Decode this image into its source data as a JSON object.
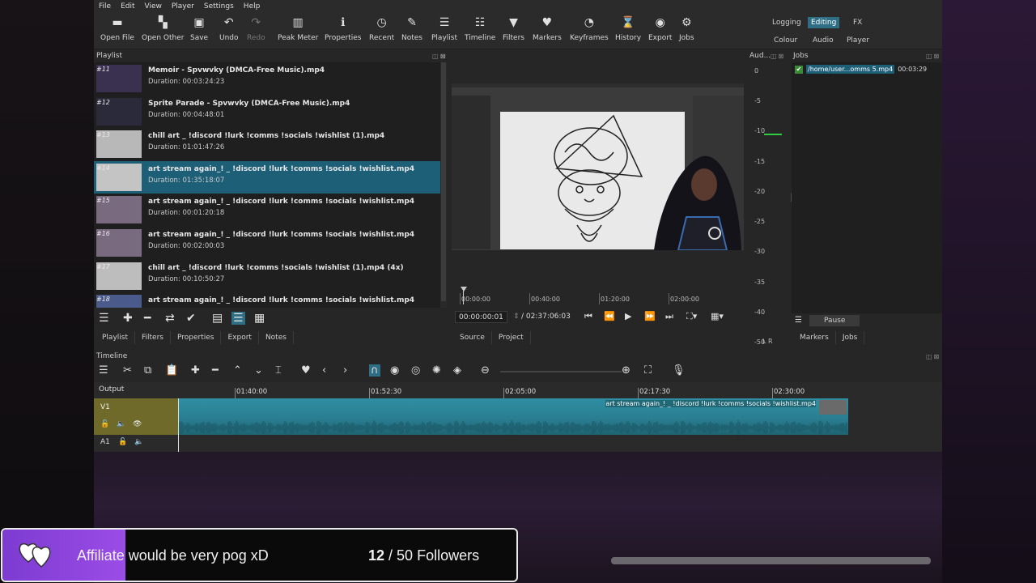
{
  "menu": [
    "File",
    "Edit",
    "View",
    "Player",
    "Settings",
    "Help"
  ],
  "toolbar": [
    {
      "label": "Open File",
      "icon": "open-file-icon",
      "glyph": "▬"
    },
    {
      "label": "Open Other",
      "icon": "open-other-icon",
      "glyph": "▚"
    },
    {
      "label": "Save",
      "icon": "save-icon",
      "glyph": "▣"
    },
    {
      "label": "Undo",
      "icon": "undo-icon",
      "glyph": "↶"
    },
    {
      "label": "Redo",
      "icon": "redo-icon",
      "glyph": "↷"
    },
    {
      "label": "Peak Meter",
      "icon": "peak-meter-icon",
      "glyph": "▥"
    },
    {
      "label": "Properties",
      "icon": "properties-icon",
      "glyph": "ℹ"
    },
    {
      "label": "Recent",
      "icon": "recent-icon",
      "glyph": "◷"
    },
    {
      "label": "Notes",
      "icon": "notes-icon",
      "glyph": "✎"
    },
    {
      "label": "Playlist",
      "icon": "playlist-icon",
      "glyph": "☰"
    },
    {
      "label": "Timeline",
      "icon": "timeline-icon",
      "glyph": "☷"
    },
    {
      "label": "Filters",
      "icon": "filters-icon",
      "glyph": "▼"
    },
    {
      "label": "Markers",
      "icon": "markers-icon",
      "glyph": "♥"
    },
    {
      "label": "Keyframes",
      "icon": "keyframes-icon",
      "glyph": "◔"
    },
    {
      "label": "History",
      "icon": "history-icon",
      "glyph": "⌛"
    },
    {
      "label": "Export",
      "icon": "export-icon",
      "glyph": "◉"
    },
    {
      "label": "Jobs",
      "icon": "jobs-icon",
      "glyph": "⚙"
    }
  ],
  "layouts": {
    "row1": [
      "Logging",
      "Editing",
      "FX"
    ],
    "row2": [
      "Colour",
      "Audio",
      "Player"
    ],
    "active": "Editing"
  },
  "playlist": {
    "title": "Playlist",
    "items": [
      {
        "num": "#11",
        "name": "Memoir - Spvwvky (DMCA-Free Music).mp4",
        "duration": "Duration: 00:03:24:23",
        "thumb": "#3a3050",
        "selected": false
      },
      {
        "num": "#12",
        "name": "Sprite Parade - Spvwvky (DMCA-Free Music).mp4",
        "duration": "Duration: 00:04:48:01",
        "thumb": "#2a2a3a",
        "selected": false
      },
      {
        "num": "#13",
        "name": "chill art _ !discord !lurk !comms !socials !wishlist (1).mp4",
        "duration": "Duration: 01:01:47:26",
        "thumb": "#b8b8b8",
        "selected": false
      },
      {
        "num": "#14",
        "name": "art stream again_! _ !discord !lurk !comms !socials !wishlist.mp4",
        "duration": "Duration: 01:35:18:07",
        "thumb": "#c4c4c4",
        "selected": true
      },
      {
        "num": "#15",
        "name": "art stream again_! _ !discord !lurk !comms !socials !wishlist.mp4",
        "duration": "Duration: 00:01:20:18",
        "thumb": "#7a6a80",
        "selected": false
      },
      {
        "num": "#16",
        "name": "art stream again_! _ !discord !lurk !comms !socials !wishlist.mp4",
        "duration": "Duration: 00:02:00:03",
        "thumb": "#7a6a80",
        "selected": false
      },
      {
        "num": "#17",
        "name": "chill art _ !discord !lurk !comms !socials !wishlist (1).mp4 (4x)",
        "duration": "Duration: 00:10:50:27",
        "thumb": "#bdbdbd",
        "selected": false
      },
      {
        "num": "#18",
        "name": "art stream again_! _ !discord !lurk !comms !socials !wishlist.mp4",
        "duration": "",
        "thumb": "#4a5a8a",
        "selected": false
      }
    ],
    "tabs": [
      "Playlist",
      "Filters",
      "Properties",
      "Export",
      "Notes"
    ]
  },
  "viewer": {
    "ruler": [
      "00:00:00",
      "00:40:00",
      "01:20:00",
      "02:00:00"
    ],
    "current_time": "00:00:00:01",
    "total_time": "/ 02:37:06:03",
    "tabs": [
      "Source",
      "Project"
    ]
  },
  "audio": {
    "title": "Aud...",
    "scale": [
      "0",
      "-5",
      "-10",
      "-15",
      "-20",
      "-25",
      "-30",
      "-35",
      "-40",
      "-50"
    ],
    "channels": "L  R",
    "level_db": -15
  },
  "jobs": {
    "title": "Jobs",
    "items": [
      {
        "name": "/home/user...omms 5.mp4",
        "time": "00:03:29",
        "done": true
      }
    ],
    "pause_label": "Pause",
    "tabs": [
      "Markers",
      "Jobs"
    ]
  },
  "timeline": {
    "title": "Timeline",
    "output_label": "Output",
    "ruler": [
      "01:40:00",
      "01:52:30",
      "02:05:00",
      "02:17:30",
      "02:30:00"
    ],
    "tracks": {
      "v1": "V1",
      "a1": "A1"
    },
    "clip_title": "art stream again_! _ !discord !lurk !comms !socials !wishlist.mp4"
  },
  "overlay": {
    "message": "Affiliate would be very pog xD",
    "count": "12",
    "goal": "/ 50 Followers",
    "accent": "#8a45dc"
  }
}
